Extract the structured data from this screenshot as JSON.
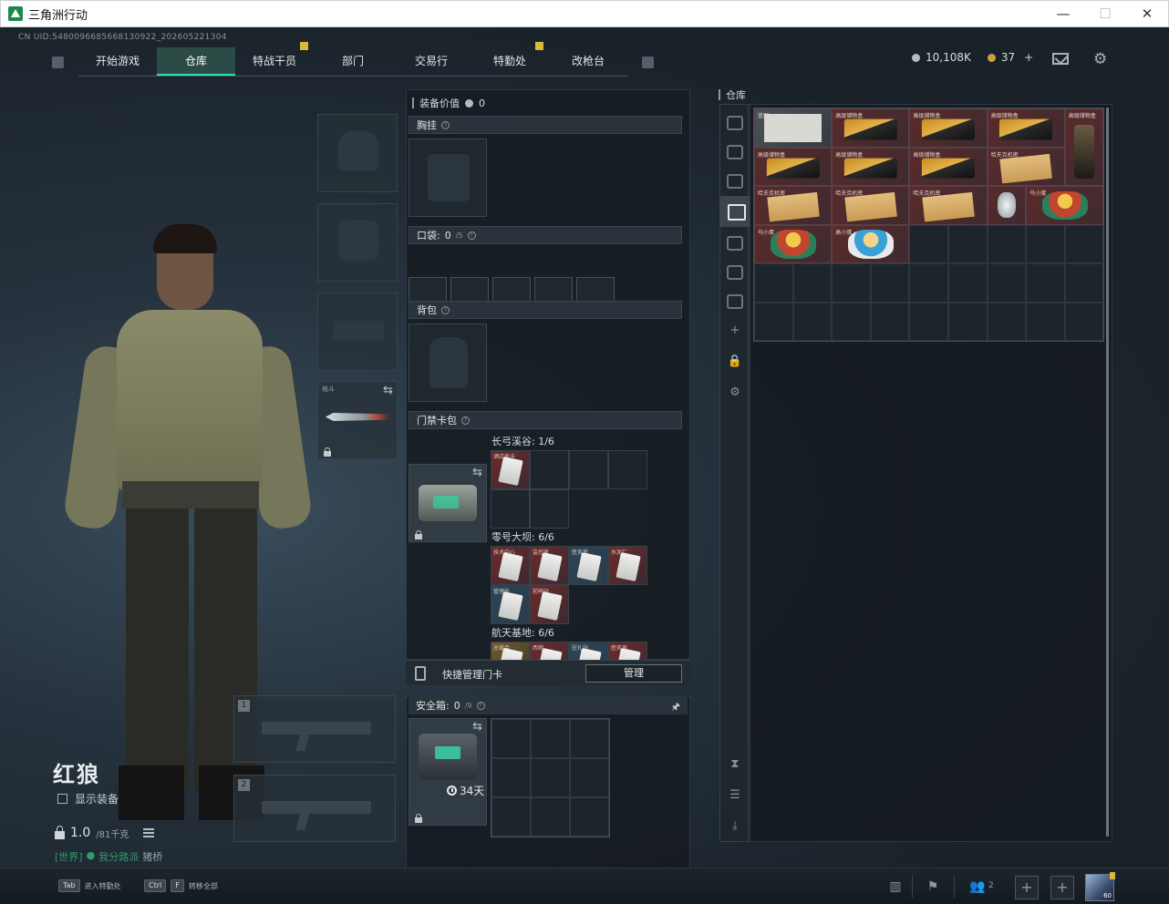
{
  "window": {
    "title": "三角洲行动",
    "controls": [
      "—",
      "☐",
      "✕"
    ]
  },
  "uid": "CN UID:5480096685668130922_202605221304",
  "nav": {
    "tabs": [
      {
        "label": "开始游戏",
        "active": false,
        "badge": false
      },
      {
        "label": "仓库",
        "active": true,
        "badge": false
      },
      {
        "label": "特战干员",
        "active": false,
        "badge": true
      },
      {
        "label": "部门",
        "active": false,
        "badge": false
      },
      {
        "label": "交易行",
        "active": false,
        "badge": false
      },
      {
        "label": "特勤处",
        "active": false,
        "badge": true
      },
      {
        "label": "改枪台",
        "active": false,
        "badge": false
      }
    ]
  },
  "currency": {
    "silver": "10,108K",
    "gold": "37",
    "plus": "+"
  },
  "operator": {
    "name": "红狼",
    "show_equipment_label": "显示装备",
    "weight": "1.0",
    "weight_capacity": "/81千克",
    "channel": {
      "world": "[世界]",
      "dot": "●",
      "team": "我分路派",
      "name": "猪桥"
    }
  },
  "melee": {
    "label": "格斗"
  },
  "weapon_slots": [
    {
      "number": "1"
    },
    {
      "number": "2"
    }
  ],
  "equipment": {
    "value_label": "装备价值",
    "value": "0",
    "chest_rig": "胸挂",
    "pockets": "口袋:",
    "pockets_count": "0",
    "pockets_cap": "/5",
    "backpack": "背包",
    "card_case": "门禁卡包"
  },
  "card_maps": [
    {
      "label": "长弓溪谷: 1/6",
      "cells": [
        {
          "name": "酒店房卡",
          "filled": true,
          "tone": "red"
        },
        {
          "name": "",
          "filled": false
        },
        {
          "name": "",
          "filled": false
        },
        {
          "name": "",
          "filled": false
        },
        {
          "name": "",
          "filled": false
        },
        {
          "name": "",
          "filled": false
        },
        {
          "name": "",
          "filled": false,
          "hidden": true
        },
        {
          "name": "",
          "filled": false,
          "hidden": true
        }
      ]
    },
    {
      "label": "零号大坝: 6/6",
      "cells": [
        {
          "name": "技术中心",
          "filled": true,
          "tone": "red"
        },
        {
          "name": "监控室",
          "filled": true,
          "tone": "red"
        },
        {
          "name": "医务室",
          "filled": true,
          "tone": "blue"
        },
        {
          "name": "水泥厂",
          "filled": true,
          "tone": "red"
        },
        {
          "name": "管理处",
          "filled": true,
          "tone": "blue"
        },
        {
          "name": "前哨站",
          "filled": true,
          "tone": "red"
        }
      ]
    },
    {
      "label": "航天基地: 6/6",
      "cells": [
        {
          "name": "总裁会",
          "filled": true,
          "tone": "gold"
        },
        {
          "name": "西侧",
          "filled": true,
          "tone": "red"
        },
        {
          "name": "驻扎站",
          "filled": true,
          "tone": "blue"
        },
        {
          "name": "医务室",
          "filled": true,
          "tone": "red"
        }
      ]
    }
  ],
  "quick_manage": {
    "label": "快捷管理门卡",
    "button": "管理"
  },
  "safe": {
    "label": "安全箱:",
    "count": "0",
    "cap": "/9",
    "timer": "34天"
  },
  "warehouse": {
    "title": "仓库",
    "items": [
      {
        "name": "蓝图",
        "kind": "doc",
        "tone": "gray",
        "col": 1,
        "row": 1,
        "w": 2,
        "h": 1
      },
      {
        "name": "高级储物盒",
        "kind": "box",
        "tone": "red",
        "col": 3,
        "row": 1,
        "w": 2,
        "h": 1
      },
      {
        "name": "高级储物盒",
        "kind": "box",
        "tone": "red",
        "col": 5,
        "row": 1,
        "w": 2,
        "h": 1
      },
      {
        "name": "高级储物盒",
        "kind": "box",
        "tone": "red",
        "col": 7,
        "row": 1,
        "w": 2,
        "h": 1
      },
      {
        "name": "高级储物盒",
        "kind": "bag",
        "tone": "red",
        "col": 9,
        "row": 1,
        "w": 1,
        "h": 2
      },
      {
        "name": "高级储物盒",
        "kind": "box",
        "tone": "red",
        "col": 1,
        "row": 2,
        "w": 2,
        "h": 1
      },
      {
        "name": "高级储物盒",
        "kind": "box",
        "tone": "red",
        "col": 3,
        "row": 2,
        "w": 2,
        "h": 1
      },
      {
        "name": "高级储物盒",
        "kind": "box",
        "tone": "red",
        "col": 5,
        "row": 2,
        "w": 2,
        "h": 1
      },
      {
        "name": "哈夫克机密",
        "kind": "paper",
        "tone": "red",
        "col": 7,
        "row": 2,
        "w": 2,
        "h": 1
      },
      {
        "name": "哈夫克机密",
        "kind": "paper",
        "tone": "red",
        "col": 1,
        "row": 3,
        "w": 2,
        "h": 1
      },
      {
        "name": "哈夫克机密",
        "kind": "paper",
        "tone": "red",
        "col": 3,
        "row": 3,
        "w": 2,
        "h": 1
      },
      {
        "name": "哈夫克机密",
        "kind": "paper",
        "tone": "red",
        "col": 5,
        "row": 3,
        "w": 2,
        "h": 1
      },
      {
        "name": "",
        "kind": "gem",
        "tone": "red",
        "col": 7,
        "row": 3,
        "w": 1,
        "h": 1
      },
      {
        "name": "马小蛋",
        "kind": "toy",
        "tone": "red",
        "col": 8,
        "row": 3,
        "w": 2,
        "h": 1
      },
      {
        "name": "马小蛋",
        "kind": "toy",
        "tone": "red",
        "col": 1,
        "row": 4,
        "w": 2,
        "h": 1
      },
      {
        "name": "高小蛋",
        "kind": "toy-blue",
        "tone": "red",
        "col": 3,
        "row": 4,
        "w": 2,
        "h": 1
      }
    ]
  },
  "bottom": {
    "hint1_key": "Tab",
    "hint1_text": "进入特勤处",
    "hint2_key1": "Ctrl",
    "hint2_key2": "F",
    "hint2_text": "转移全部",
    "team_count": "2",
    "avatar_level": "60"
  },
  "colors": {
    "accent": "#2de3b0",
    "badge": "#d8b93a"
  }
}
